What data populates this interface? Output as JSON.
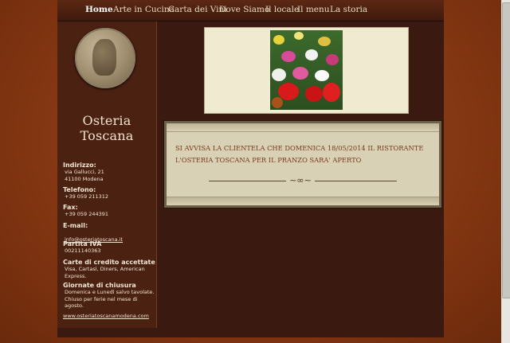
{
  "nav": {
    "items": [
      {
        "label": "Home",
        "active": true
      },
      {
        "label": "Arte in Cucina"
      },
      {
        "label": "Carta dei Vini"
      },
      {
        "label": "Dove Siamo"
      },
      {
        "label": "Il locale"
      },
      {
        "label": "Il menu"
      },
      {
        "label": "La storia"
      }
    ]
  },
  "sidebar": {
    "brand": "Osteria Toscana",
    "address_label": "Indirizzo:",
    "address_value": "via Gallucci, 21\n41100 Modena",
    "phone_label": "Telefono:",
    "phone_value": "+39 059 211312",
    "fax_label": "Fax:",
    "fax_value": "+39 059 244391",
    "email_label": "E-mail:",
    "email_value": "info@osteriatoscana.it",
    "vat_label": "Partita IVA",
    "vat_value": "00211140363",
    "cards_label": "Carte di credito accettate",
    "cards_value": "Visa, Cartasì, Diners, American\nExpress.",
    "closing_label": "Giornate di chiusura",
    "closing_value": "Domenica e Lunedì salvo tavolate.\nChiuso per ferie nel mese di agosto.",
    "website": "www.osteriatoscanamodena.com"
  },
  "notice": {
    "text": "SI AVVISA LA CLIENTELA CHE DOMENICA 18/05/2014 IL RISTORANTE L'OSTERIA TOSCANA PER IL PRANZO SARA' APERTO",
    "ornament": "~∞~"
  },
  "colors": {
    "background": "#8a3a14",
    "page": "#3a1a10",
    "sidebar": "#4b2112",
    "notice_bg": "#d8d1b6",
    "notice_text": "#7a3818"
  },
  "icons": {
    "medallion": "dante-portrait-medallion",
    "photo": "flower-market-photo"
  }
}
